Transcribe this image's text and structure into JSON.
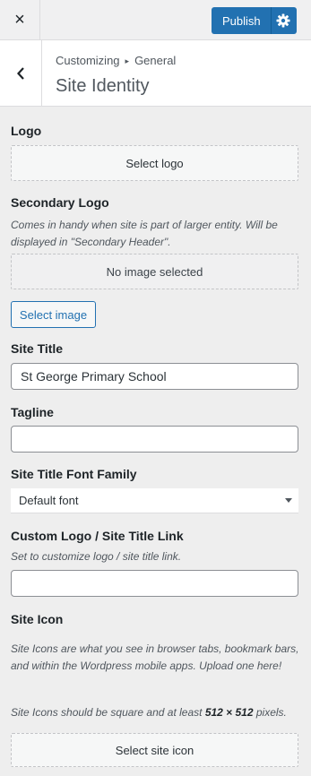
{
  "topbar": {
    "close_icon": "×",
    "publish_label": "Publish"
  },
  "header": {
    "breadcrumb_root": "Customizing",
    "breadcrumb_arrow": "▸",
    "breadcrumb_section": "General",
    "title": "Site Identity"
  },
  "logo": {
    "title": "Logo",
    "button": "Select logo"
  },
  "secondary_logo": {
    "title": "Secondary Logo",
    "description": "Comes in handy when site is part of larger entity. Will be displayed in \"Secondary Header\".",
    "placeholder": "No image selected",
    "button": "Select image"
  },
  "site_title": {
    "title": "Site Title",
    "value": "St George Primary School"
  },
  "tagline": {
    "title": "Tagline",
    "value": ""
  },
  "font_family": {
    "title": "Site Title Font Family",
    "selected": "Default font"
  },
  "custom_link": {
    "title": "Custom Logo / Site Title Link",
    "description": "Set to customize logo / site title link.",
    "value": ""
  },
  "site_icon": {
    "title": "Site Icon",
    "description1": "Site Icons are what you see in browser tabs, bookmark bars, and within the Wordpress mobile apps. Upload one here!",
    "description2_pre": "Site Icons should be square and at least ",
    "description2_size": "512 × 512",
    "description2_post": " pixels.",
    "button": "Select site icon"
  },
  "colors": {
    "accent": "#2271b1",
    "background": "#eeeeee"
  }
}
